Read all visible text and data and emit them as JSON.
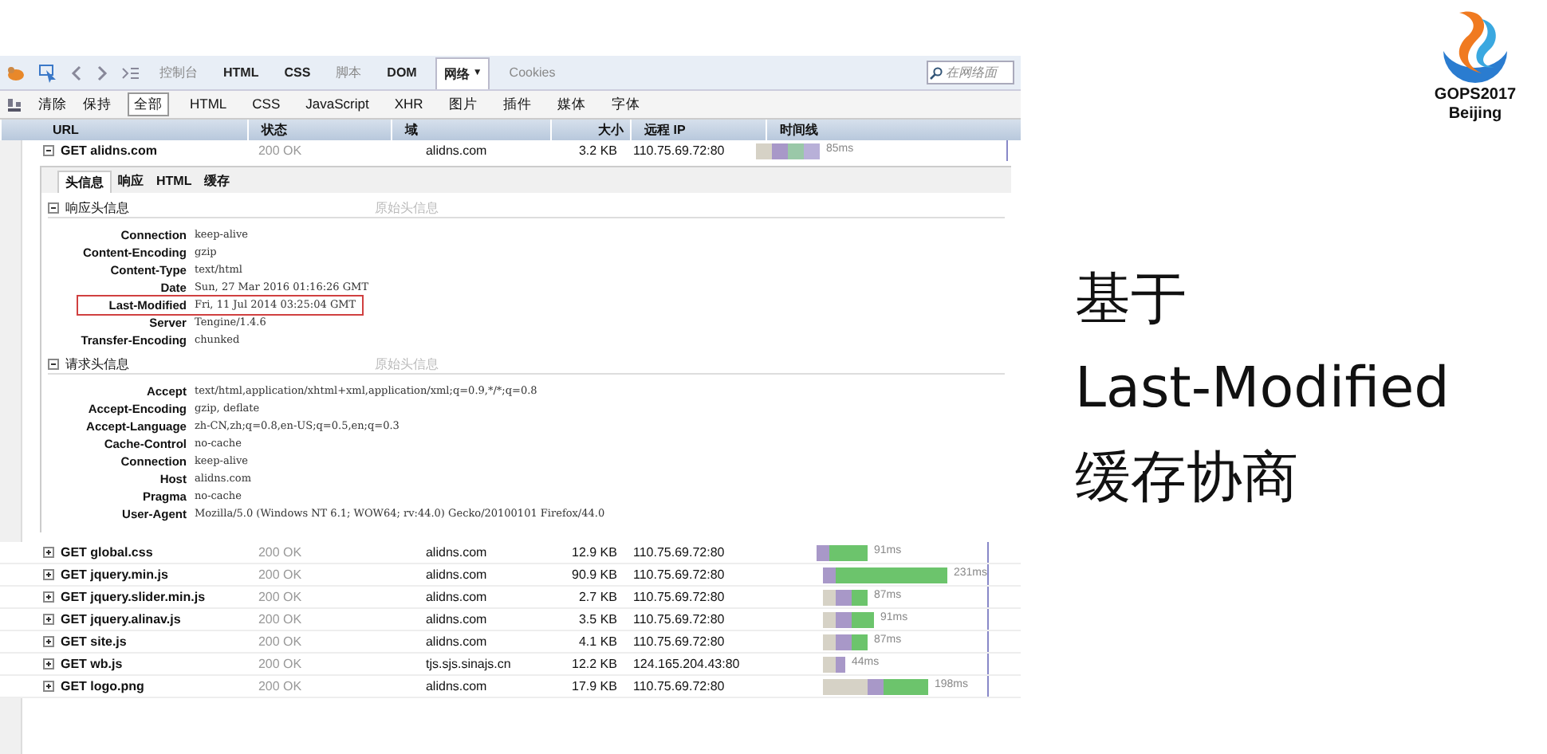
{
  "toolbar": {
    "tabs": [
      {
        "label": "控制台",
        "selected": false,
        "dim": true
      },
      {
        "label": "HTML",
        "selected": false,
        "dim": false
      },
      {
        "label": "CSS",
        "selected": false,
        "dim": false
      },
      {
        "label": "脚本",
        "selected": false,
        "dim": true
      },
      {
        "label": "DOM",
        "selected": false,
        "dim": false
      },
      {
        "label": "网络",
        "selected": true,
        "dim": false,
        "menu_glyph": "▼"
      },
      {
        "label": "Cookies",
        "selected": false,
        "dim": true
      }
    ],
    "search": {
      "placeholder": "在网络面"
    }
  },
  "filter_bar": {
    "buttons": [
      "清除",
      "保持"
    ],
    "filters": [
      {
        "label": "全部",
        "selected": true
      },
      {
        "label": "HTML",
        "selected": false
      },
      {
        "label": "CSS",
        "selected": false
      },
      {
        "label": "JavaScript",
        "selected": false
      },
      {
        "label": "XHR",
        "selected": false
      },
      {
        "label": "图片",
        "selected": false
      },
      {
        "label": "插件",
        "selected": false
      },
      {
        "label": "媒体",
        "selected": false
      },
      {
        "label": "字体",
        "selected": false
      }
    ]
  },
  "table": {
    "columns": [
      "URL",
      "状态",
      "域",
      "大小",
      "远程 IP",
      "时间线"
    ],
    "expanded_request": {
      "url": "GET alidns.com",
      "status": "200 OK",
      "domain": "alidns.com",
      "size": "3.2 KB",
      "ip": "110.75.69.72:80",
      "time": "85ms",
      "expanded": true,
      "subtabs": [
        {
          "label": "头信息",
          "selected": true
        },
        {
          "label": "响应",
          "selected": false
        },
        {
          "label": "HTML",
          "selected": false
        },
        {
          "label": "缓存",
          "selected": false
        }
      ],
      "sections": [
        {
          "title": "响应头信息",
          "link": "原始头信息",
          "expanded": true,
          "headers": [
            {
              "name": "Connection",
              "value": "keep-alive",
              "highlighted": false
            },
            {
              "name": "Content-Encoding",
              "value": "gzip",
              "highlighted": false
            },
            {
              "name": "Content-Type",
              "value": "text/html",
              "highlighted": false
            },
            {
              "name": "Date",
              "value": "Sun, 27 Mar 2016 01:16:26 GMT",
              "highlighted": false
            },
            {
              "name": "Last-Modified",
              "value": "Fri, 11 Jul 2014 03:25:04 GMT",
              "highlighted": true
            },
            {
              "name": "Server",
              "value": "Tengine/1.4.6",
              "highlighted": false
            },
            {
              "name": "Transfer-Encoding",
              "value": "chunked",
              "highlighted": false
            }
          ]
        },
        {
          "title": "请求头信息",
          "link": "原始头信息",
          "expanded": true,
          "headers": [
            {
              "name": "Accept",
              "value": "text/html,application/xhtml+xml,application/xml;q=0.9,*/*;q=0.8",
              "highlighted": false
            },
            {
              "name": "Accept-Encoding",
              "value": "gzip, deflate",
              "highlighted": false
            },
            {
              "name": "Accept-Language",
              "value": "zh-CN,zh;q=0.8,en-US;q=0.5,en;q=0.3",
              "highlighted": false
            },
            {
              "name": "Cache-Control",
              "value": "no-cache",
              "highlighted": false
            },
            {
              "name": "Connection",
              "value": "keep-alive",
              "highlighted": false
            },
            {
              "name": "Host",
              "value": "alidns.com",
              "highlighted": false
            },
            {
              "name": "Pragma",
              "value": "no-cache",
              "highlighted": false
            },
            {
              "name": "User-Agent",
              "value": "Mozilla/5.0 (Windows NT 6.1; WOW64; rv:44.0) Gecko/20100101 Firefox/44.0",
              "highlighted": false
            }
          ]
        }
      ]
    },
    "rows": [
      {
        "url": "GET global.css",
        "status": "200 OK",
        "domain": "alidns.com",
        "size": "12.9 KB",
        "ip": "110.75.69.72:80",
        "time": "91ms",
        "expanded": false
      },
      {
        "url": "GET jquery.min.js",
        "status": "200 OK",
        "domain": "alidns.com",
        "size": "90.9 KB",
        "ip": "110.75.69.72:80",
        "time": "231ms",
        "expanded": false
      },
      {
        "url": "GET jquery.slider.min.js",
        "status": "200 OK",
        "domain": "alidns.com",
        "size": "2.7 KB",
        "ip": "110.75.69.72:80",
        "time": "87ms",
        "expanded": false
      },
      {
        "url": "GET jquery.alinav.js",
        "status": "200 OK",
        "domain": "alidns.com",
        "size": "3.5 KB",
        "ip": "110.75.69.72:80",
        "time": "91ms",
        "expanded": false
      },
      {
        "url": "GET site.js",
        "status": "200 OK",
        "domain": "alidns.com",
        "size": "4.1 KB",
        "ip": "110.75.69.72:80",
        "time": "87ms",
        "expanded": false
      },
      {
        "url": "GET wb.js",
        "status": "200 OK",
        "domain": "tjs.sjs.sinajs.cn",
        "size": "12.2 KB",
        "ip": "124.165.204.43:80",
        "time": "44ms",
        "expanded": false
      },
      {
        "url": "GET logo.png",
        "status": "200 OK",
        "domain": "alidns.com",
        "size": "17.9 KB",
        "ip": "110.75.69.72:80",
        "time": "198ms",
        "expanded": false
      }
    ]
  },
  "slide": {
    "heading": [
      "基于",
      "Last-Modified",
      "缓存协商"
    ],
    "logo_caption": [
      "GOPS2017",
      "Beijing"
    ]
  }
}
